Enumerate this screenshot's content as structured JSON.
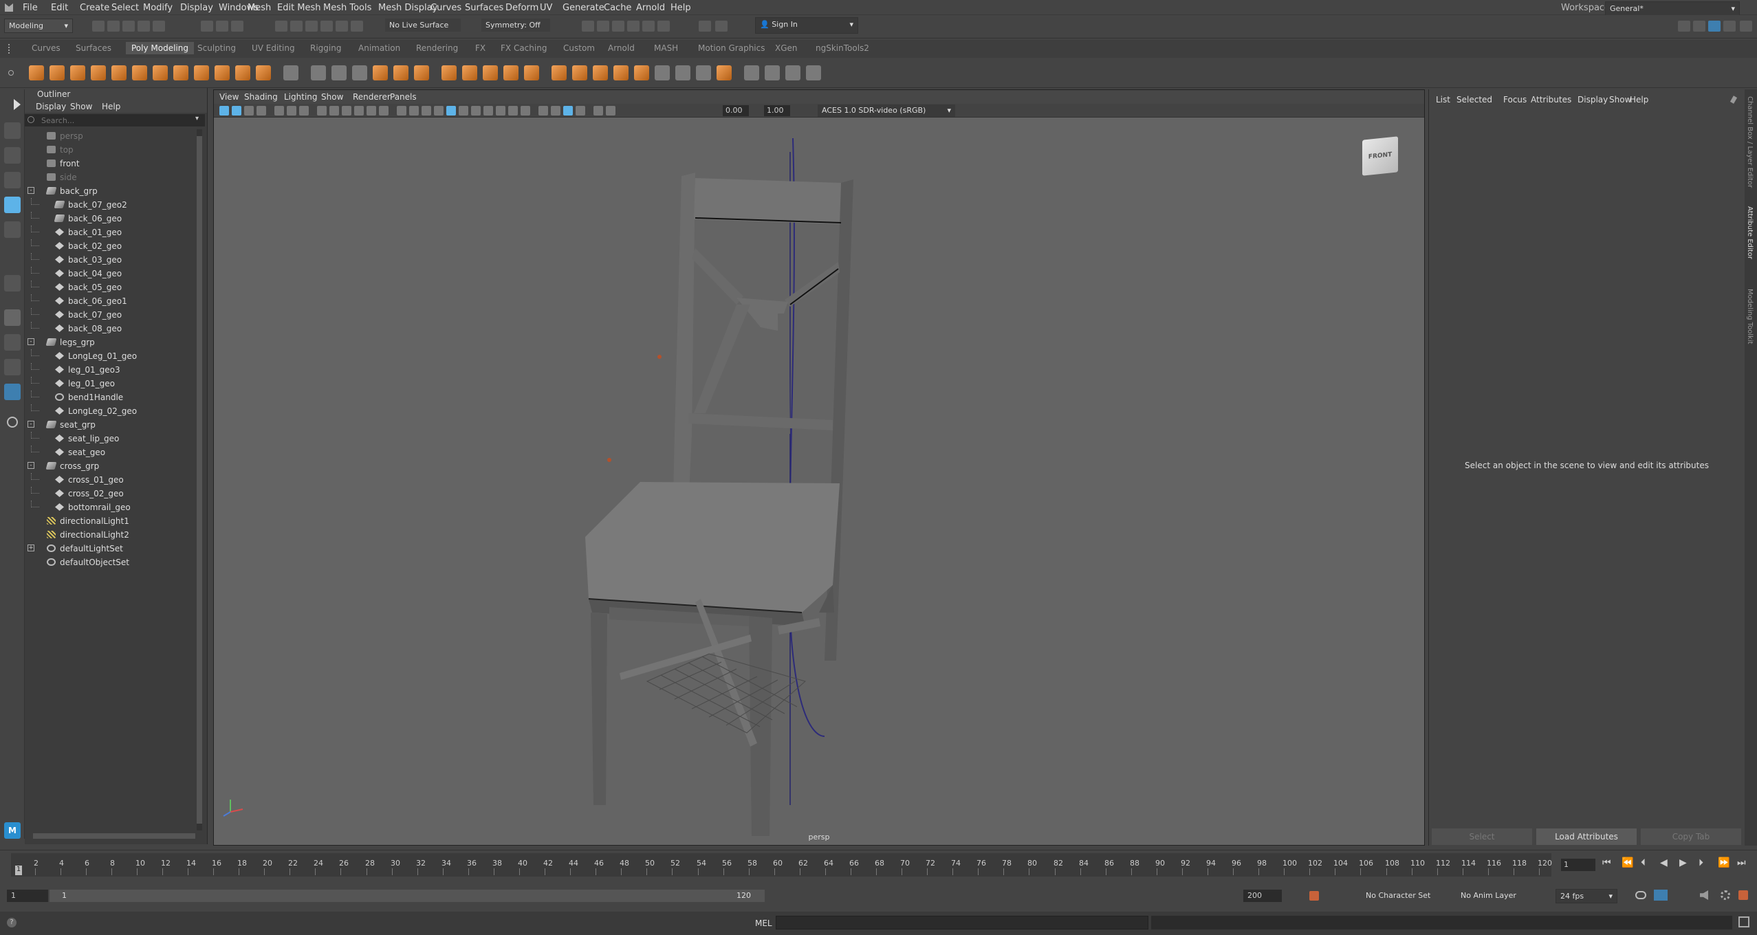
{
  "menubar": {
    "items": [
      "File",
      "Edit",
      "Create",
      "Select",
      "Modify",
      "Display",
      "Windows",
      "Mesh",
      "Edit Mesh",
      "Mesh Tools",
      "Mesh Display",
      "Curves",
      "Surfaces",
      "Deform",
      "UV",
      "Generate",
      "Cache",
      "Arnold",
      "Help"
    ],
    "workspace_label": "Workspace:",
    "workspace_value": "General*"
  },
  "statusline": {
    "mode": "Modeling",
    "live_surface": "No Live Surface",
    "symmetry": "Symmetry: Off",
    "sign_in": "Sign In"
  },
  "shelf": {
    "tabs": [
      "Curves",
      "Surfaces",
      "Poly Modeling",
      "Sculpting",
      "UV Editing",
      "Rigging",
      "Animation",
      "Rendering",
      "FX",
      "FX Caching",
      "Custom",
      "Arnold",
      "MASH",
      "Motion Graphics",
      "XGen",
      "ngSkinTools2"
    ],
    "active_tab": "Poly Modeling"
  },
  "outliner": {
    "title": "Outliner",
    "menu": [
      "Display",
      "Show",
      "Help"
    ],
    "search_placeholder": "Search...",
    "items": [
      {
        "label": "persp",
        "icon": "camera-icon",
        "level": 2,
        "dim": true
      },
      {
        "label": "top",
        "icon": "camera-icon",
        "level": 2,
        "dim": true
      },
      {
        "label": "front",
        "icon": "camera-icon",
        "level": 2,
        "dim": false
      },
      {
        "label": "side",
        "icon": "camera-icon",
        "level": 2,
        "dim": true
      },
      {
        "label": "back_grp",
        "icon": "group-icon",
        "level": 1,
        "expander": "-"
      },
      {
        "label": "back_07_geo2",
        "icon": "group-icon",
        "level": 3
      },
      {
        "label": "back_06_geo",
        "icon": "group-icon",
        "level": 3
      },
      {
        "label": "back_01_geo",
        "icon": "mesh-icon",
        "level": 3
      },
      {
        "label": "back_02_geo",
        "icon": "mesh-icon",
        "level": 3
      },
      {
        "label": "back_03_geo",
        "icon": "mesh-icon",
        "level": 3
      },
      {
        "label": "back_04_geo",
        "icon": "mesh-icon",
        "level": 3
      },
      {
        "label": "back_05_geo",
        "icon": "mesh-icon",
        "level": 3
      },
      {
        "label": "back_06_geo1",
        "icon": "mesh-icon",
        "level": 3
      },
      {
        "label": "back_07_geo",
        "icon": "mesh-icon",
        "level": 3
      },
      {
        "label": "back_08_geo",
        "icon": "mesh-icon",
        "level": 3
      },
      {
        "label": "legs_grp",
        "icon": "group-icon",
        "level": 1,
        "expander": "-"
      },
      {
        "label": "LongLeg_01_geo",
        "icon": "mesh-icon",
        "level": 3
      },
      {
        "label": "leg_01_geo3",
        "icon": "mesh-icon",
        "level": 3
      },
      {
        "label": "leg_01_geo",
        "icon": "mesh-icon",
        "level": 3
      },
      {
        "label": "bend1Handle",
        "icon": "handle-icon",
        "level": 3
      },
      {
        "label": "LongLeg_02_geo",
        "icon": "mesh-icon",
        "level": 3
      },
      {
        "label": "seat_grp",
        "icon": "group-icon",
        "level": 1,
        "expander": "-"
      },
      {
        "label": "seat_lip_geo",
        "icon": "mesh-icon",
        "level": 3
      },
      {
        "label": "seat_geo",
        "icon": "mesh-icon",
        "level": 3
      },
      {
        "label": "cross_grp",
        "icon": "group-icon",
        "level": 1,
        "expander": "-"
      },
      {
        "label": "cross_01_geo",
        "icon": "mesh-icon",
        "level": 3
      },
      {
        "label": "cross_02_geo",
        "icon": "mesh-icon",
        "level": 3
      },
      {
        "label": "bottomrail_geo",
        "icon": "mesh-icon",
        "level": 3
      },
      {
        "label": "directionalLight1",
        "icon": "light-icon",
        "level": 2
      },
      {
        "label": "directionalLight2",
        "icon": "light-icon",
        "level": 2
      },
      {
        "label": "defaultLightSet",
        "icon": "set-icon",
        "level": 1,
        "expander": "+"
      },
      {
        "label": "defaultObjectSet",
        "icon": "set-icon",
        "level": 1
      }
    ]
  },
  "viewport": {
    "menu": [
      "View",
      "Shading",
      "Lighting",
      "Show",
      "Renderer",
      "Panels"
    ],
    "exposure": "0.00",
    "gamma": "1.00",
    "color_space": "ACES 1.0 SDR-video (sRGB)",
    "camera_label": "persp",
    "view_cube_label": "FRONT"
  },
  "attribute_editor": {
    "menu": [
      "List",
      "Selected",
      "Focus",
      "Attributes",
      "Display",
      "Show",
      "Help"
    ],
    "empty_message": "Select an object in the scene to view and edit its attributes",
    "buttons": [
      "Select",
      "Load Attributes",
      "Copy Tab"
    ]
  },
  "side_tabs": [
    "Channel Box / Layer Editor",
    "Attribute Editor",
    "Modeling Toolkit"
  ],
  "timeline": {
    "ticks": [
      "2",
      "4",
      "6",
      "8",
      "10",
      "12",
      "14",
      "16",
      "18",
      "20",
      "22",
      "24",
      "26",
      "28",
      "30",
      "32",
      "34",
      "36",
      "38",
      "40",
      "42",
      "44",
      "46",
      "48",
      "50",
      "52",
      "54",
      "56",
      "58",
      "60",
      "62",
      "64",
      "66",
      "68",
      "70",
      "72",
      "74",
      "76",
      "78",
      "80",
      "82",
      "84",
      "86",
      "88",
      "90",
      "92",
      "94",
      "96",
      "98",
      "100",
      "102",
      "104",
      "106",
      "108",
      "110",
      "112",
      "114",
      "116",
      "118",
      "120"
    ],
    "current_marker": "1",
    "current_frame": "1"
  },
  "range": {
    "start": "1",
    "playback_start": "1",
    "playback_end": "120",
    "end": "200",
    "character_set": "No Character Set",
    "anim_layer": "No Anim Layer",
    "fps": "24 fps"
  },
  "cmdline": {
    "label": "MEL"
  }
}
